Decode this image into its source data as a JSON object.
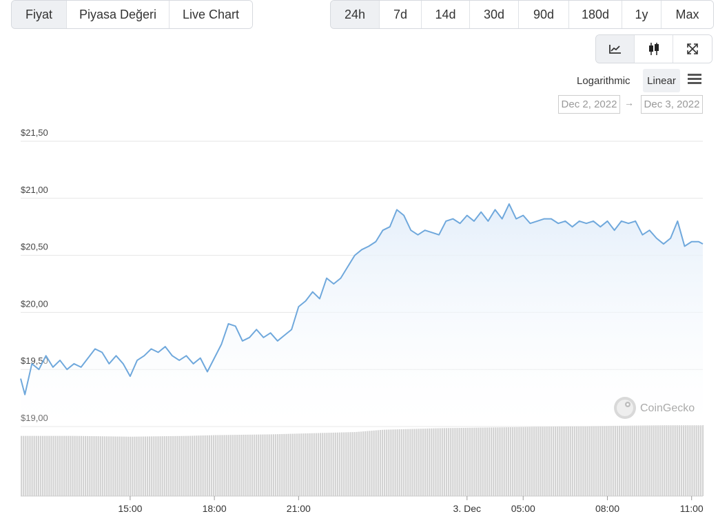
{
  "tabs": [
    {
      "label": "Fiyat",
      "active": true
    },
    {
      "label": "Piyasa Değeri",
      "active": false
    },
    {
      "label": "Live Chart",
      "active": false
    }
  ],
  "ranges": [
    {
      "label": "24h",
      "active": true
    },
    {
      "label": "7d",
      "active": false
    },
    {
      "label": "14d",
      "active": false
    },
    {
      "label": "30d",
      "active": false
    },
    {
      "label": "90d",
      "active": false
    },
    {
      "label": "180d",
      "active": false
    },
    {
      "label": "1y",
      "active": false
    },
    {
      "label": "Max",
      "active": false
    }
  ],
  "chart_types": [
    "line-chart-icon",
    "candlestick-icon",
    "fullscreen-icon"
  ],
  "scale": {
    "log_label": "Logarithmic",
    "linear_label": "Linear",
    "selected": "Linear"
  },
  "date_range": {
    "from": "Dec 2, 2022",
    "to": "Dec 3, 2022",
    "arrow": "→"
  },
  "watermark": "CoinGecko",
  "colors": {
    "line": "#6fa8dc",
    "area_top": "#e3eefa",
    "volume": "#d3d3d3",
    "grid": "#e6e6e6"
  },
  "chart_data": {
    "type": "area",
    "title": "",
    "y_ticks": [
      "$19,00",
      "$19,50",
      "$20,00",
      "$20,50",
      "$21,00",
      "$21,50"
    ],
    "y_tick_values": [
      19.0,
      19.5,
      20.0,
      20.5,
      21.0,
      21.5
    ],
    "ylim": [
      19.0,
      21.5
    ],
    "x_ticks": [
      "15:00",
      "18:00",
      "21:00",
      "3. Dec",
      "05:00",
      "08:00",
      "11:00"
    ],
    "x_tick_hours": [
      15,
      18,
      21,
      27,
      29,
      32,
      35
    ],
    "xlim": [
      11.1,
      35.4
    ],
    "x_unit": "hours since Dec 2 00:00",
    "price_series": {
      "x": [
        11.1,
        11.25,
        11.5,
        11.75,
        12.0,
        12.25,
        12.5,
        12.75,
        13.0,
        13.25,
        13.5,
        13.75,
        14.0,
        14.25,
        14.5,
        14.75,
        15.0,
        15.25,
        15.5,
        15.75,
        16.0,
        16.25,
        16.5,
        16.75,
        17.0,
        17.25,
        17.5,
        17.75,
        18.0,
        18.25,
        18.5,
        18.75,
        19.0,
        19.25,
        19.5,
        19.75,
        20.0,
        20.25,
        20.5,
        20.75,
        21.0,
        21.25,
        21.5,
        21.75,
        22.0,
        22.25,
        22.5,
        22.75,
        23.0,
        23.25,
        23.5,
        23.75,
        24.0,
        24.25,
        24.5,
        24.75,
        25.0,
        25.25,
        25.5,
        25.75,
        26.0,
        26.25,
        26.5,
        26.75,
        27.0,
        27.25,
        27.5,
        27.75,
        28.0,
        28.25,
        28.5,
        28.75,
        29.0,
        29.25,
        29.5,
        29.75,
        30.0,
        30.25,
        30.5,
        30.75,
        31.0,
        31.25,
        31.5,
        31.75,
        32.0,
        32.25,
        32.5,
        32.75,
        33.0,
        33.25,
        33.5,
        33.75,
        34.0,
        34.25,
        34.5,
        34.75,
        35.0,
        35.25,
        35.4
      ],
      "y": [
        19.42,
        19.28,
        19.55,
        19.5,
        19.62,
        19.52,
        19.58,
        19.5,
        19.55,
        19.52,
        19.6,
        19.68,
        19.65,
        19.55,
        19.62,
        19.55,
        19.44,
        19.58,
        19.62,
        19.68,
        19.65,
        19.7,
        19.62,
        19.58,
        19.62,
        19.55,
        19.6,
        19.48,
        19.6,
        19.72,
        19.9,
        19.88,
        19.75,
        19.78,
        19.85,
        19.78,
        19.82,
        19.75,
        19.8,
        19.85,
        20.05,
        20.1,
        20.18,
        20.12,
        20.3,
        20.25,
        20.3,
        20.4,
        20.5,
        20.55,
        20.58,
        20.62,
        20.72,
        20.75,
        20.9,
        20.85,
        20.72,
        20.68,
        20.72,
        20.7,
        20.68,
        20.8,
        20.82,
        20.78,
        20.85,
        20.8,
        20.88,
        20.8,
        20.9,
        20.82,
        20.95,
        20.82,
        20.85,
        20.78,
        20.8,
        20.82,
        20.82,
        20.78,
        20.8,
        20.75,
        20.8,
        20.78,
        20.8,
        20.75,
        20.8,
        20.72,
        20.8,
        20.78,
        20.8,
        20.68,
        20.72,
        20.65,
        20.6,
        20.65,
        20.8,
        20.58,
        20.62,
        20.62,
        20.6
      ]
    },
    "volume_series": {
      "note": "relative trading volume bars (no axis values shown)",
      "x": [
        11.1,
        13.0,
        15.0,
        17.0,
        18.0,
        20.0,
        21.0,
        22.0,
        23.0,
        24.0,
        26.0,
        28.0,
        30.0,
        32.0,
        34.0,
        35.4
      ],
      "y": [
        0.78,
        0.78,
        0.77,
        0.78,
        0.79,
        0.8,
        0.81,
        0.82,
        0.83,
        0.86,
        0.88,
        0.89,
        0.9,
        0.91,
        0.92,
        0.92
      ]
    },
    "grid": true,
    "legend": "none"
  }
}
